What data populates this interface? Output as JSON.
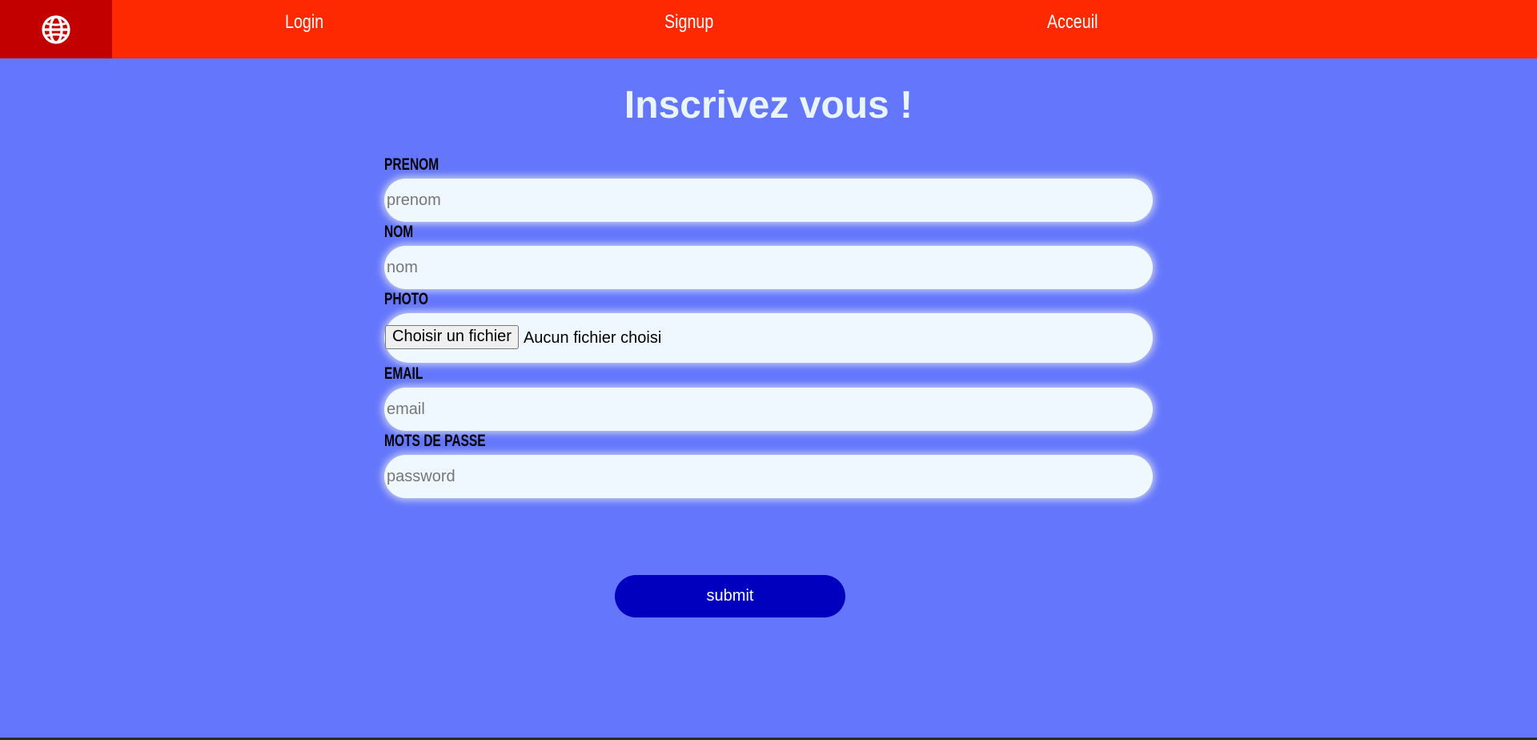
{
  "nav": {
    "logo_icon": "globe-icon",
    "login": "Login",
    "signup": "Signup",
    "accueil": "Acceuil"
  },
  "form": {
    "title": "Inscrivez vous !",
    "prenom": {
      "label": "PRENOM",
      "placeholder": "prenom",
      "value": ""
    },
    "nom": {
      "label": "NOM",
      "placeholder": "nom",
      "value": ""
    },
    "photo": {
      "label": "PHOTO",
      "button": "Choisir un fichier",
      "status": "Aucun fichier choisi"
    },
    "email": {
      "label": "EMAIL",
      "placeholder": "email",
      "value": ""
    },
    "password": {
      "label": "MOTS DE PASSE",
      "placeholder": "password",
      "value": ""
    },
    "submit": "submit"
  },
  "colors": {
    "background": "#6477fc",
    "navbar": "#ff2900",
    "logo_box": "#c20000",
    "submit": "#0000be",
    "input_bg": "#eff8ff"
  }
}
